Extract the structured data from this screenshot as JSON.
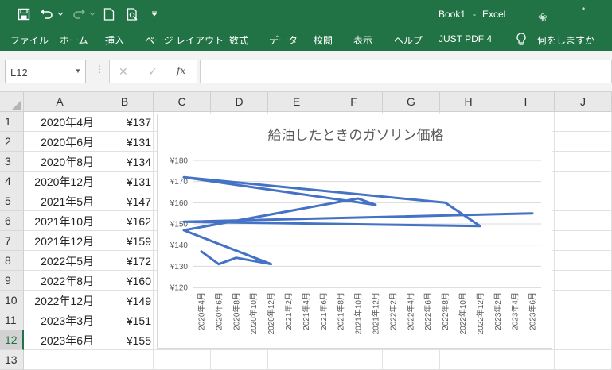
{
  "window": {
    "title": "Book1",
    "separator": "-",
    "app": "Excel"
  },
  "quick_access": [
    {
      "name": "save-icon"
    },
    {
      "name": "undo-icon"
    },
    {
      "name": "redo-icon"
    },
    {
      "name": "new-file-icon"
    },
    {
      "name": "print-preview-icon"
    },
    {
      "name": "customize-qat-icon"
    }
  ],
  "ribbon": {
    "tabs": [
      "ファイル",
      "ホーム",
      "挿入",
      "ページ レイアウト",
      "数式",
      "データ",
      "校閲",
      "表示",
      "ヘルプ",
      "JUST PDF 4"
    ],
    "tell_me": "何をしますか"
  },
  "formula_bar": {
    "name_box": "L12",
    "value": ""
  },
  "columns": [
    "A",
    "B",
    "C",
    "D",
    "E",
    "F",
    "G",
    "H",
    "I",
    "J"
  ],
  "rows": [
    "1",
    "2",
    "3",
    "4",
    "5",
    "6",
    "7",
    "8",
    "9",
    "10",
    "11",
    "12",
    "13"
  ],
  "selected_row": "12",
  "cells_a": [
    "2020年4月",
    "2020年6月",
    "2020年8月",
    "2020年12月",
    "2021年5月",
    "2021年10月",
    "2021年12月",
    "2022年5月",
    "2022年8月",
    "2022年12月",
    "2023年3月",
    "2023年6月"
  ],
  "cells_b": [
    "¥137",
    "¥131",
    "¥134",
    "¥131",
    "¥147",
    "¥162",
    "¥159",
    "¥172",
    "¥160",
    "¥149",
    "¥151",
    "¥155"
  ],
  "colors": {
    "excel_green": "#217346",
    "series": "#4472C4"
  },
  "chart_data": {
    "type": "line",
    "title": "給油したときのガソリン価格",
    "x_axis": "time",
    "categories": [
      "2020年4月",
      "2020年6月",
      "2020年8月",
      "2020年10月",
      "2020年12月",
      "2021年2月",
      "2021年4月",
      "2021年6月",
      "2021年8月",
      "2021年10月",
      "2021年12月",
      "2022年2月",
      "2022年4月",
      "2022年6月",
      "2022年8月",
      "2022年10月",
      "2022年12月",
      "2023年2月",
      "2023年4月",
      "2023年6月"
    ],
    "points": [
      {
        "x": "2020年4月",
        "y": 137
      },
      {
        "x": "2020年6月",
        "y": 131
      },
      {
        "x": "2020年8月",
        "y": 134
      },
      {
        "x": "2020年12月",
        "y": 131
      },
      {
        "x": "2021年5月",
        "y": 147
      },
      {
        "x": "2021年10月",
        "y": 162
      },
      {
        "x": "2021年12月",
        "y": 159
      },
      {
        "x": "2022年5月",
        "y": 172
      },
      {
        "x": "2022年8月",
        "y": 160
      },
      {
        "x": "2022年12月",
        "y": 149
      },
      {
        "x": "2023年3月",
        "y": 151
      },
      {
        "x": "2023年6月",
        "y": 155
      }
    ],
    "y_ticks": [
      "¥120",
      "¥130",
      "¥140",
      "¥150",
      "¥160",
      "¥170",
      "¥180"
    ],
    "ylim": [
      120,
      180
    ],
    "grid": true,
    "legend": false
  }
}
